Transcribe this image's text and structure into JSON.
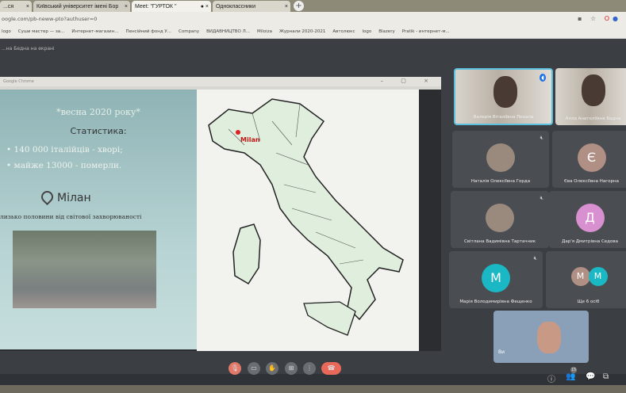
{
  "browser": {
    "tabs": [
      {
        "label": "...ся"
      },
      {
        "label": "Київський університет імені Бор"
      },
      {
        "label": "Meet: \"ГУРТОК \""
      },
      {
        "label": "Одноклассники"
      }
    ],
    "url": "oogle.com/pb-neww-pto?authuser=0",
    "bookmarks": [
      "logo",
      "Суши мастер — за...",
      "Интернет-магазин...",
      "Пенсійний фонд У...",
      "Company",
      "ВИДАВНИЦТВО Л...",
      "Miloiza",
      "Журнали 2020-2021",
      "Автолюкс",
      "logo",
      "Blazery",
      "Pratik - интернет-м..."
    ]
  },
  "meet": {
    "presenting_label": "...на Бедна на екрані",
    "window_title": "Google Chrome",
    "slide": {
      "season": "*весна 2020 року*",
      "stats_title": "Статистика:",
      "bullets": [
        "140 000 італійців - хворі;",
        "майже 13000 - померли."
      ],
      "city": "Мілан",
      "caption": "лизько половини від світової захворюваності"
    },
    "map": {
      "label": "Milan",
      "marker_color": "#e02020"
    },
    "participants": [
      {
        "name": "Валерія Віталіївна Пехала",
        "video": true,
        "speaking": true
      },
      {
        "name": "Алла Анатоліївна Бедна",
        "video": true
      },
      {
        "name": "Наталія Олексіївна Горда",
        "photo": true
      },
      {
        "name": "Єва Олексіївна Нагорна",
        "initial": "Є",
        "color": "#b08f84"
      },
      {
        "name": "Світлана Вадимівна Тартачник",
        "photo": true
      },
      {
        "name": "Дар'я Дмитрівна Седова",
        "initial": "Д",
        "color": "#d890d0"
      },
      {
        "name": "Марія Володимирівна Фещенко",
        "initial": "М",
        "color": "#19b8c4"
      },
      {
        "name": "Ще 6 осіб",
        "initials": [
          "М",
          "М"
        ]
      }
    ],
    "self_label": "Ви",
    "participant_count": "15",
    "end_call_color": "#e8685a"
  }
}
